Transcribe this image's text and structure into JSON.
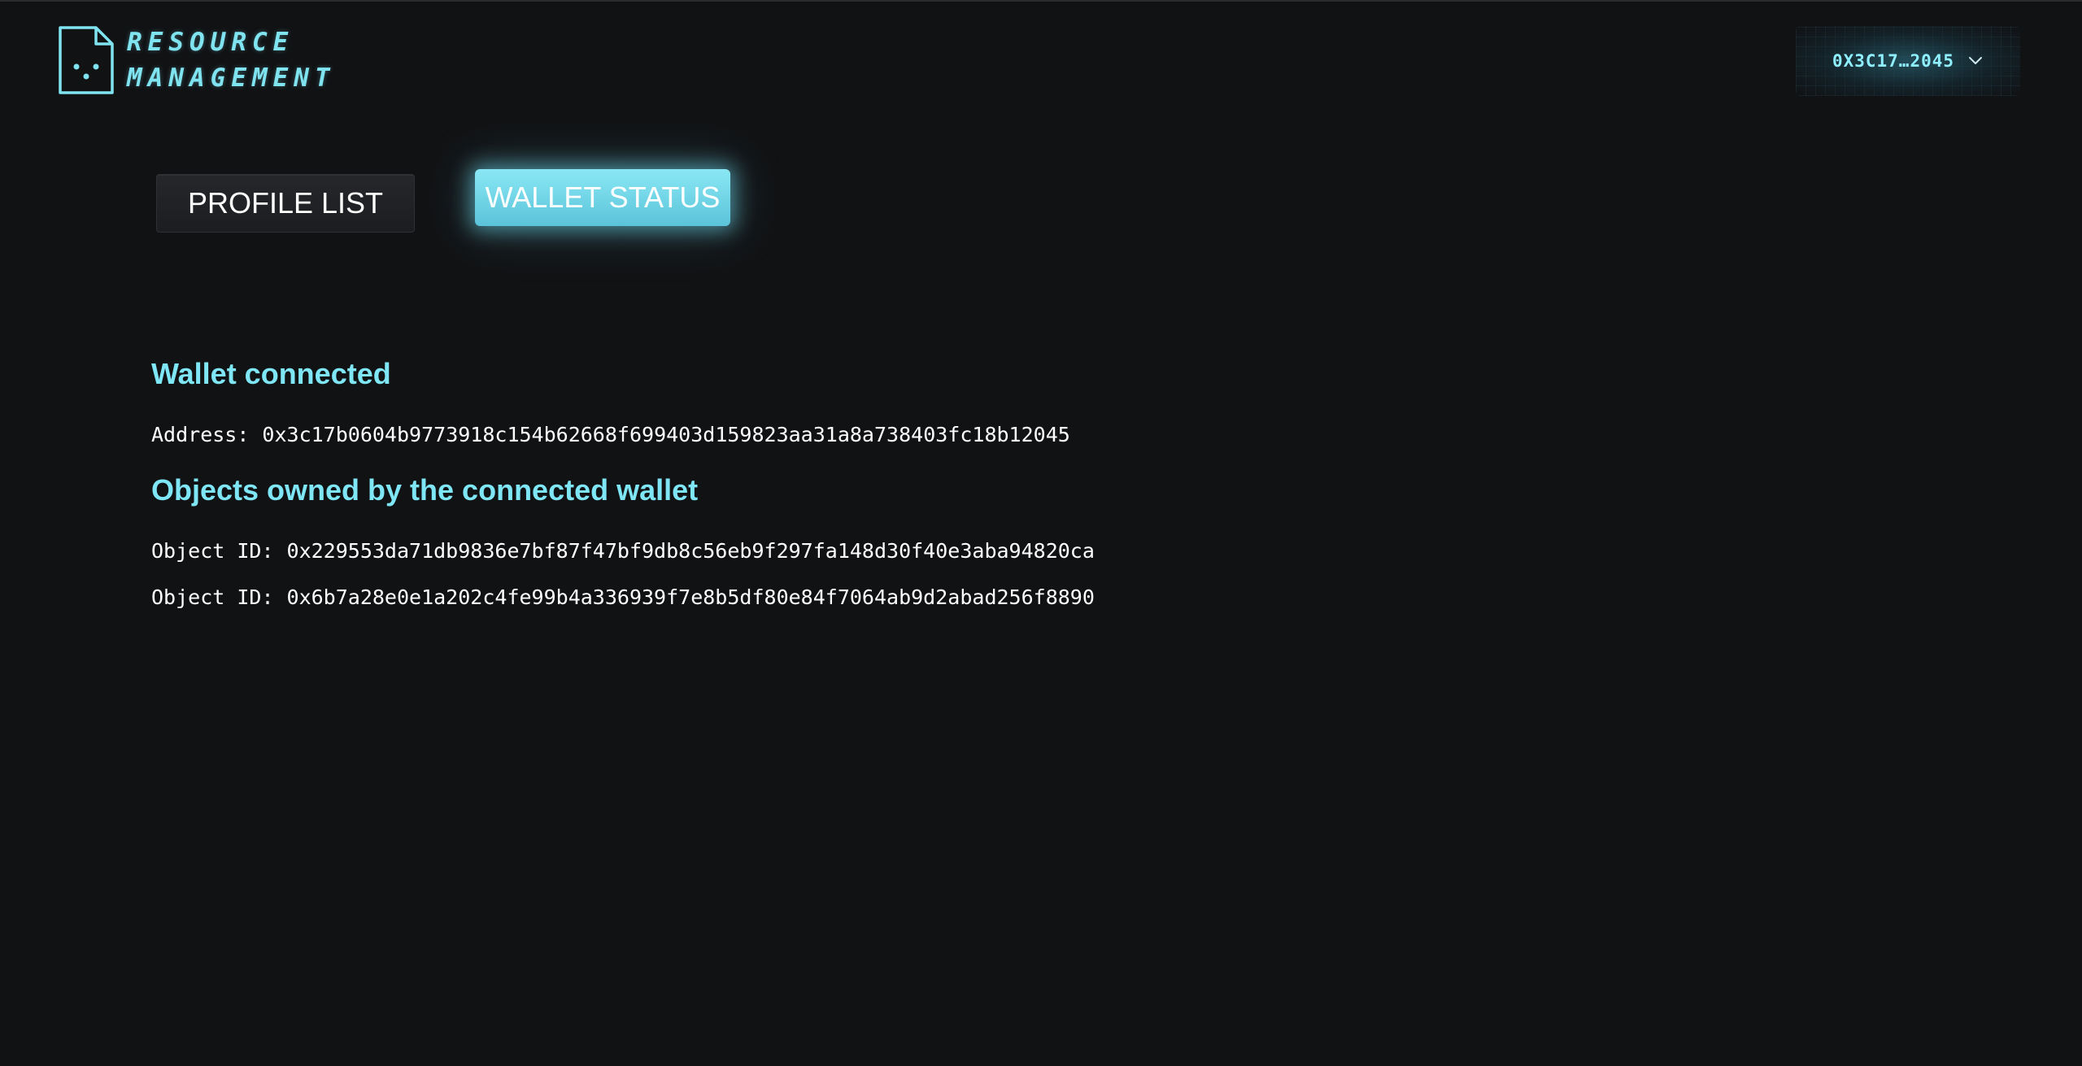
{
  "header": {
    "logo_line1": "RESOURCE",
    "logo_line2": "MANAGEMENT",
    "wallet_short": "0X3C17…2045"
  },
  "tabs": [
    {
      "label": "PROFILE LIST",
      "active": false
    },
    {
      "label": "WALLET STATUS",
      "active": true
    }
  ],
  "wallet": {
    "status_title": "Wallet connected",
    "address_label": "Address:",
    "address": "0x3c17b0604b9773918c154b62668f699403d159823aa31a8a738403fc18b12045"
  },
  "objects": {
    "title": "Objects owned by the connected wallet",
    "label": "Object ID:",
    "items": [
      "0x229553da71db9836e7bf87f47bf9db8c56eb9f297fa148d30f40e3aba94820ca",
      "0x6b7a28e0e1a202c4fe99b4a336939f7e8b5df80e84f7064ab9d2abad256f8890"
    ]
  },
  "colors": {
    "background": "#111214",
    "accent": "#7ee6f5",
    "active_tab": "#6fd3e6"
  },
  "icons": {
    "logo": "document-face-icon",
    "dropdown": "chevron-down-icon"
  }
}
